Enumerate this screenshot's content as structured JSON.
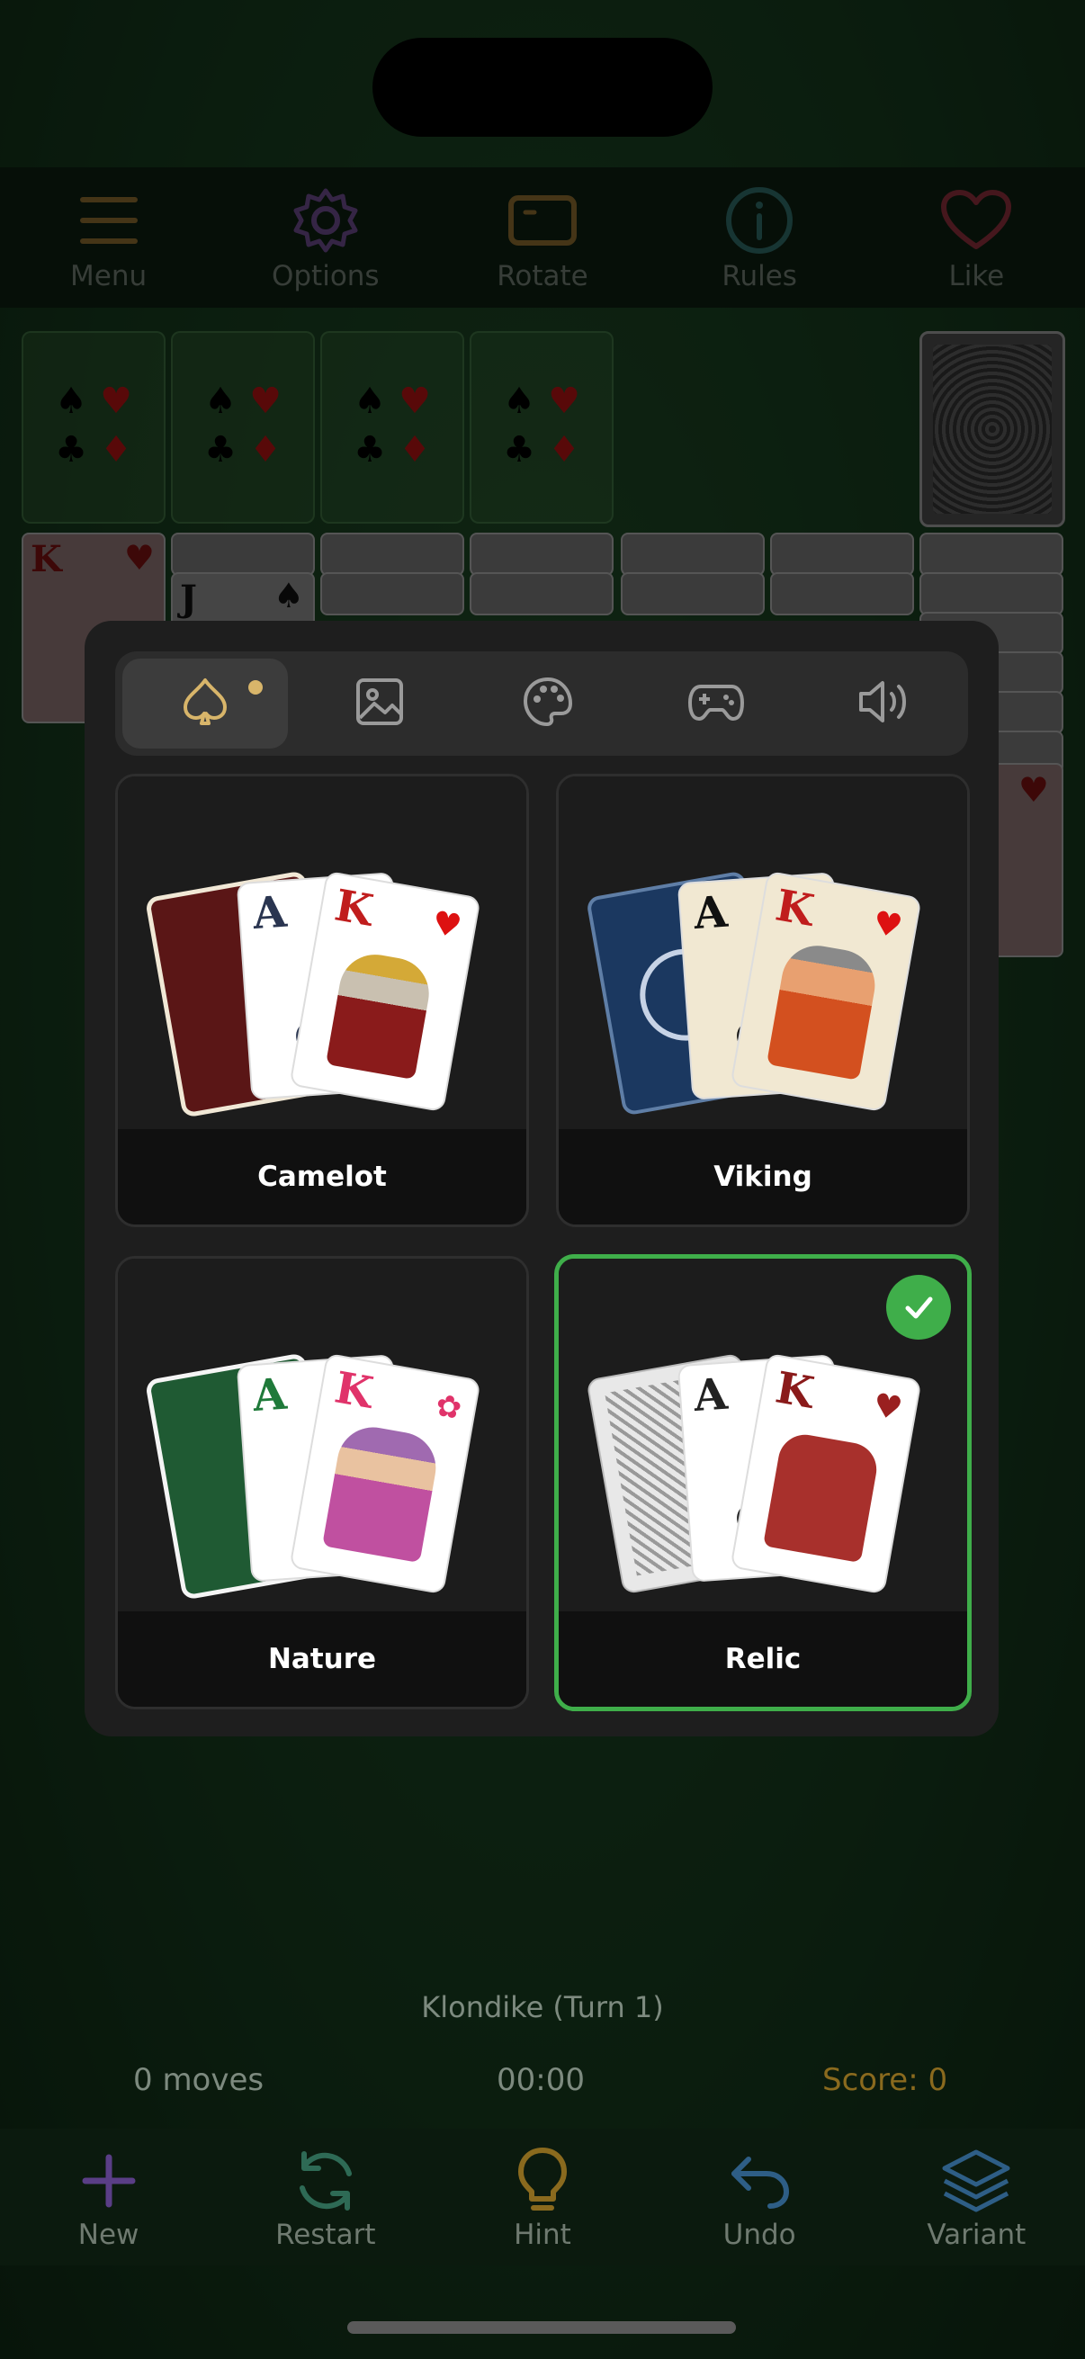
{
  "toolbar": {
    "menu": "Menu",
    "options": "Options",
    "rotate": "Rotate",
    "rules": "Rules",
    "like": "Like"
  },
  "table": {
    "tableau_top_ranks": [
      "K",
      "J"
    ]
  },
  "settings": {
    "tabs": [
      "card-deck-icon",
      "background-image-icon",
      "theme-palette-icon",
      "gamepad-icon",
      "sound-icon"
    ],
    "decks": [
      {
        "name": "Camelot",
        "ace": "A",
        "king": "K",
        "selected": false
      },
      {
        "name": "Viking",
        "ace": "A",
        "king": "K",
        "selected": false
      },
      {
        "name": "Nature",
        "ace": "A",
        "king": "K",
        "selected": false
      },
      {
        "name": "Relic",
        "ace": "A",
        "king": "K",
        "selected": true
      }
    ]
  },
  "game": {
    "title": "Klondike (Turn 1)",
    "moves": "0 moves",
    "time": "00:00",
    "score": "Score: 0"
  },
  "bottombar": {
    "new": "New",
    "restart": "Restart",
    "hint": "Hint",
    "undo": "Undo",
    "variant": "Variant"
  },
  "colors": {
    "menu": "#8a6a2e",
    "options": "#6a4a8a",
    "rotate": "#8a6a2e",
    "rules": "#2e6a66",
    "like": "#8a2e3a",
    "accent_green": "#3fae4a",
    "score": "#8a6a1e"
  }
}
